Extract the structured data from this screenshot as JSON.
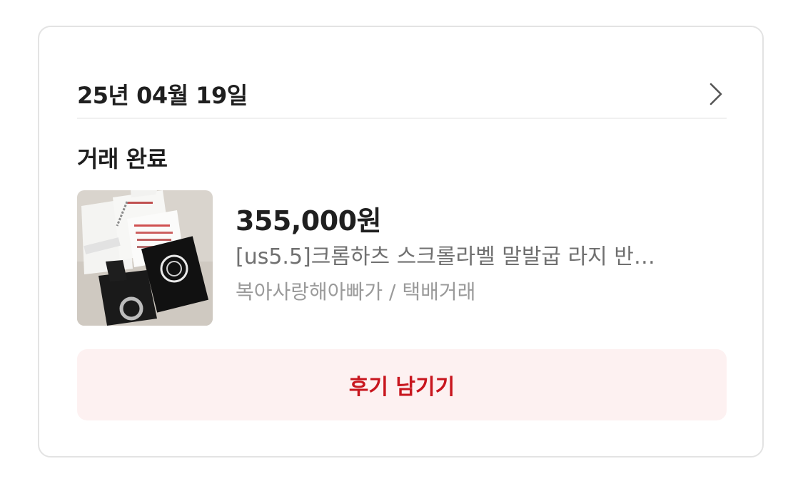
{
  "order": {
    "date": "25년 04월 19일",
    "status": "거래 완료",
    "price": "355,000원",
    "title": "[us5.5]크롬하츠 스크롤라벨 말발굽 라지 반…",
    "seller_and_method": "복아사랑해아빠가 / 택배거래",
    "review_button_label": "후기 남기기"
  },
  "icons": {
    "detail": "chevron-right-icon",
    "thumbnail": "product-photo"
  },
  "colors": {
    "accent": "#c8161e",
    "button_bg": "#fdf1f1",
    "border": "#e3e3e3",
    "secondary_text": "#707070",
    "tertiary_text": "#9a9a9a"
  }
}
